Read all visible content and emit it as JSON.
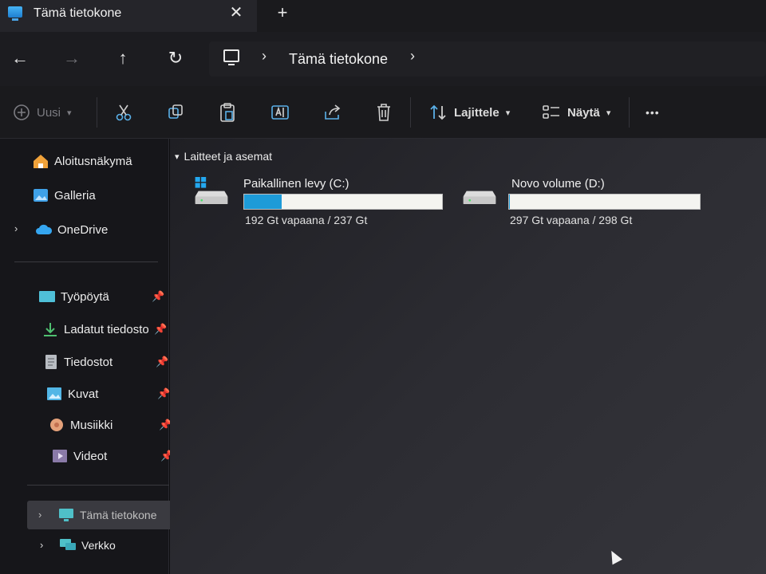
{
  "window": {
    "tab_title": "Tämä tietokone",
    "close_glyph": "✕",
    "new_tab_glyph": "+"
  },
  "nav": {
    "back_glyph": "←",
    "forward_glyph": "→",
    "up_glyph": "↑",
    "refresh_glyph": "↻",
    "breadcrumb": "Tämä tietokone",
    "sep_glyph": "›"
  },
  "toolbar": {
    "new_label": "Uusi",
    "sort_label": "Lajittele",
    "view_label": "Näytä",
    "more_glyph": "•••"
  },
  "sidebar": {
    "quick": [
      {
        "label": "Aloitusnäkymä",
        "icon": "home-icon"
      },
      {
        "label": "Galleria",
        "icon": "gallery-icon"
      },
      {
        "label": "OneDrive",
        "icon": "cloud-icon"
      }
    ],
    "pinned": [
      {
        "label": "Työpöytä",
        "icon": "desktop-icon"
      },
      {
        "label": "Ladatut tiedosto",
        "icon": "download-icon"
      },
      {
        "label": "Tiedostot",
        "icon": "document-icon"
      },
      {
        "label": "Kuvat",
        "icon": "pictures-icon"
      },
      {
        "label": "Musiikki",
        "icon": "music-icon"
      },
      {
        "label": "Videot",
        "icon": "video-icon"
      }
    ],
    "bottom": [
      {
        "label": "Tämä tietokone",
        "icon": "pc-icon"
      },
      {
        "label": "Verkko",
        "icon": "network-icon"
      }
    ],
    "pin_glyph": "📌",
    "chevron_glyph": "›"
  },
  "main": {
    "group_title": "Laitteet ja asemat",
    "drives": [
      {
        "name": "Paikallinen levy (C:)",
        "free": "192 Gt vapaana / 237 Gt",
        "used_fraction": 0.19
      },
      {
        "name": "Novo volume (D:)",
        "free": "297 Gt vapaana / 298 Gt",
        "used_fraction": 0.003
      }
    ]
  },
  "colors": {
    "accent": "#1d9bd8",
    "background": "#0d0d0f"
  }
}
